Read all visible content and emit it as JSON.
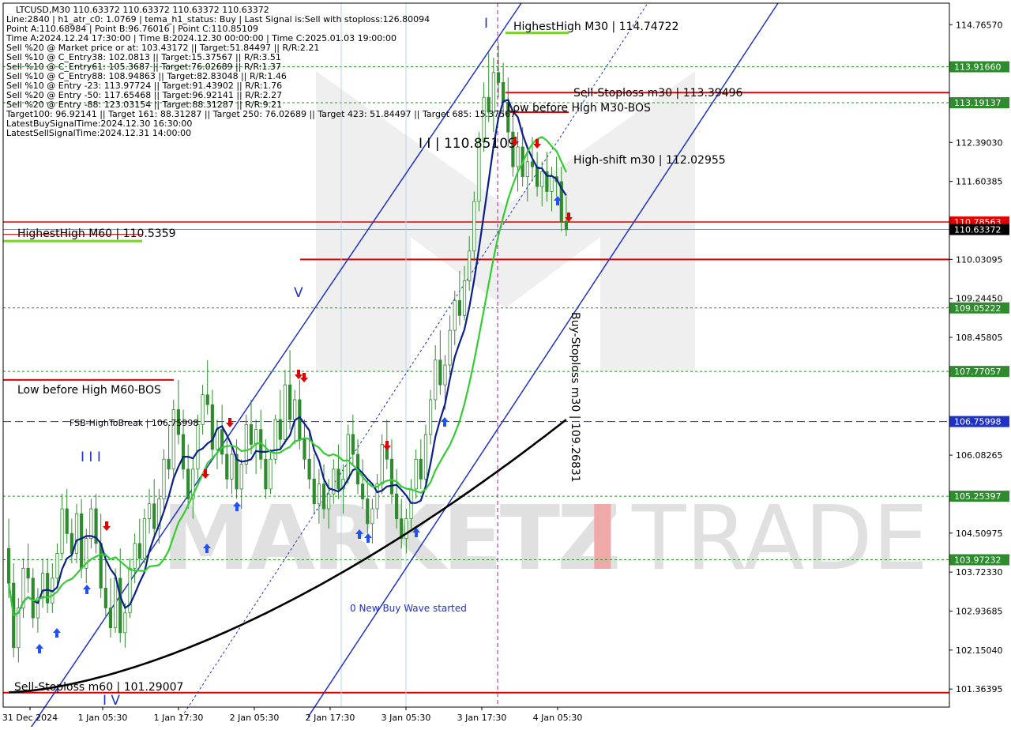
{
  "header": {
    "title": "LTCUSD,M30  110.63372 110.63372 110.63372 110.63372",
    "lines": [
      "Line:2840  |  h1_atr_c0: 1.0769  |  tema_h1_status: Buy  |  Last Signal is:Sell with stoploss:126.80094",
      "Point A:110.68984  |  Point B:96.76016  |  Point C:110.85109",
      "Time A:2024.12.24 17:30:00  |  Time B:2024.12.30 00:00:00  |  Time C:2025.01.03 19:00:00",
      "Sell %20 @ Market price or at: 103.43172  ||  Target:51.84497  ||  R/R:2.21",
      "Sell %10 @ C_Entry38: 102.0813  ||  Target:15.37567  ||  R/R:3.51",
      "Sell %10 @ C_Entry61: 105.3687  ||  Target:76.02689  ||  R/R:1.37",
      "Sell %10 @ C_Entry88: 108.94863  ||  Target:82.83048  ||  R/R:1.46",
      "Sell %10 @ Entry -23: 113.97724  ||  Target:91.43902  ||  R/R:1.76",
      "Sell %20 @ Entry -50: 117.65468  ||  Target:96.92141  ||  R/R:2.27",
      "Sell %20 @ Entry -88: 123.03154  ||  Target:88.31287  ||  R/R:9.21",
      "Target100: 96.92141  ||  Target 161: 88.31287  ||  Target 250: 76.02689  ||  Target 423: 51.84497  ||  Target 685: 15.37567",
      "LatestBuySignalTime:2024.12.30 16:30:00",
      "LatestSellSignalTime:2024.12.31 14:00:00"
    ]
  },
  "chart_data": {
    "type": "candlestick",
    "symbol": "LTCUSD",
    "timeframe": "M30",
    "ylim": [
      101.0,
      115.2
    ],
    "y_ticks": [
      "114.76570",
      "112.39030",
      "111.60385",
      "110.03095",
      "109.24450",
      "108.45805",
      "106.08265",
      "104.50975",
      "103.72330",
      "102.93685",
      "102.15040",
      "101.36395"
    ],
    "x_ticks": [
      "31 Dec 2024",
      "1 Jan 05:30",
      "1 Jan 17:30",
      "2 Jan 05:30",
      "2 Jan 17:30",
      "3 Jan 05:30",
      "3 Jan 17:30",
      "4 Jan 05:30"
    ],
    "x_count": 145,
    "current_price": {
      "value": 110.63372,
      "label": "110.63372"
    },
    "price_levels": [
      {
        "value": 113.9166,
        "label": "113.91660",
        "color": "#2e8b2e",
        "style": "dotted"
      },
      {
        "value": 113.19137,
        "label": "113.19137",
        "color": "#2e8b2e",
        "style": "dotted"
      },
      {
        "value": 110.78563,
        "label": "110.78563",
        "color": "#e00000",
        "style": "solid"
      },
      {
        "value": 109.05222,
        "label": "109.05222",
        "color": "#2e8b2e",
        "style": "dotted"
      },
      {
        "value": 107.77057,
        "label": "107.77057",
        "color": "#2e8b2e",
        "style": "dotted"
      },
      {
        "value": 106.75998,
        "label": "106.75998",
        "color": "#1e32c8",
        "style": "dashed"
      },
      {
        "value": 105.25397,
        "label": "105.25397",
        "color": "#2e8b2e",
        "style": "dotted"
      },
      {
        "value": 103.97232,
        "label": "103.97232",
        "color": "#2e8b2e",
        "style": "dotted"
      }
    ],
    "annotations": {
      "highest_high_m30": "HighestHigh   M30 | 114.74722",
      "sell_stoploss_m30": "Sell-Stoploss m30 | 113.39496",
      "low_before_high_m30": "Low before High   M30-BOS",
      "point_c": "I I | 110.85109",
      "high_shift_m30": "High-shift m30 | 112.02955",
      "highest_high_m60": "HighestHigh   M60 | 110.5359",
      "low_before_high_m60": "Low before High   M60-BOS",
      "fsb": "FSB-HighToBreak | 106.75998",
      "buy_stoploss_m30": "Buy-Stoploss m30 | 109.26831",
      "new_buy_wave": "0 New Buy Wave started",
      "sell_stoploss_m60": "Sell-Stoploss m60 | 101.29007",
      "wave_I": "I",
      "wave_V": "V",
      "wave_III": "I I I",
      "wave_IV": "I V"
    },
    "watermark": {
      "left": "MARKETZ",
      "accent": "I",
      "right": "TRADE"
    },
    "colors": {
      "bull": "#2e8b2e",
      "bear": "#2e8b2e",
      "ma_blue": "#0b1f8c",
      "ma_green": "#33cc33",
      "ma_black": "#000000",
      "channel": "#1e32c8",
      "red": "#e00000",
      "orange": "#ff6a1a"
    },
    "candles": [
      [
        104.2,
        104.8,
        103.2,
        103.5
      ],
      [
        103.5,
        103.9,
        102.0,
        102.2
      ],
      [
        102.2,
        103.2,
        101.9,
        103.0
      ],
      [
        103.0,
        104.0,
        102.8,
        103.8
      ],
      [
        103.8,
        104.3,
        103.3,
        103.6
      ],
      [
        103.6,
        103.8,
        102.6,
        102.8
      ],
      [
        102.8,
        103.4,
        102.5,
        103.2
      ],
      [
        103.2,
        104.0,
        103.0,
        103.7
      ],
      [
        103.7,
        104.0,
        102.9,
        103.1
      ],
      [
        103.1,
        103.9,
        102.9,
        103.6
      ],
      [
        103.6,
        104.3,
        103.4,
        104.1
      ],
      [
        104.1,
        105.3,
        104.0,
        105.0
      ],
      [
        105.0,
        105.4,
        104.3,
        104.5
      ],
      [
        104.5,
        104.8,
        103.9,
        104.1
      ],
      [
        104.1,
        105.1,
        103.9,
        104.9
      ],
      [
        104.9,
        105.2,
        103.6,
        103.8
      ],
      [
        103.8,
        104.6,
        103.5,
        104.4
      ],
      [
        104.4,
        105.2,
        104.2,
        105.0
      ],
      [
        105.0,
        105.3,
        104.1,
        104.3
      ],
      [
        104.3,
        104.9,
        103.2,
        103.4
      ],
      [
        103.4,
        104.1,
        102.8,
        103.0
      ],
      [
        103.0,
        103.6,
        102.4,
        102.6
      ],
      [
        102.6,
        103.8,
        102.5,
        103.6
      ],
      [
        103.6,
        104.2,
        102.3,
        102.5
      ],
      [
        102.5,
        103.1,
        102.2,
        102.9
      ],
      [
        102.9,
        104.0,
        102.8,
        103.8
      ],
      [
        103.8,
        104.5,
        103.5,
        104.3
      ],
      [
        104.3,
        104.8,
        103.8,
        104.0
      ],
      [
        104.0,
        105.0,
        103.9,
        104.8
      ],
      [
        104.8,
        105.4,
        104.5,
        105.1
      ],
      [
        105.1,
        105.6,
        104.4,
        104.6
      ],
      [
        104.6,
        105.4,
        104.3,
        105.2
      ],
      [
        105.2,
        106.2,
        105.0,
        106.0
      ],
      [
        106.0,
        106.7,
        105.6,
        105.8
      ],
      [
        105.8,
        107.2,
        105.6,
        107.0
      ],
      [
        107.0,
        107.6,
        106.3,
        106.5
      ],
      [
        106.5,
        107.0,
        105.6,
        105.8
      ],
      [
        105.8,
        106.3,
        105.0,
        105.2
      ],
      [
        105.2,
        106.0,
        104.8,
        105.8
      ],
      [
        105.8,
        106.9,
        105.6,
        106.7
      ],
      [
        106.7,
        107.5,
        106.5,
        107.3
      ],
      [
        107.3,
        108.0,
        106.9,
        107.1
      ],
      [
        107.1,
        107.4,
        106.0,
        106.2
      ],
      [
        106.2,
        106.8,
        105.8,
        106.6
      ],
      [
        106.6,
        107.1,
        105.9,
        106.1
      ],
      [
        106.1,
        106.5,
        105.4,
        105.6
      ],
      [
        105.6,
        106.3,
        105.3,
        106.1
      ],
      [
        106.1,
        106.4,
        105.2,
        105.4
      ],
      [
        105.4,
        106.0,
        105.0,
        105.9
      ],
      [
        105.9,
        106.9,
        105.7,
        106.7
      ],
      [
        106.7,
        107.2,
        106.1,
        106.3
      ],
      [
        106.3,
        106.8,
        105.7,
        106.6
      ],
      [
        106.6,
        107.0,
        105.8,
        106.0
      ],
      [
        106.0,
        106.4,
        105.2,
        105.4
      ],
      [
        105.4,
        106.2,
        105.3,
        106.0
      ],
      [
        106.0,
        106.9,
        105.9,
        106.8
      ],
      [
        106.8,
        107.4,
        106.2,
        106.4
      ],
      [
        106.4,
        107.8,
        106.3,
        107.5
      ],
      [
        107.5,
        108.2,
        106.6,
        106.8
      ],
      [
        106.8,
        107.4,
        106.3,
        107.2
      ],
      [
        107.2,
        107.6,
        106.2,
        106.4
      ],
      [
        106.4,
        106.8,
        105.8,
        106.0
      ],
      [
        106.0,
        106.6,
        105.4,
        105.6
      ],
      [
        105.6,
        106.1,
        104.9,
        105.1
      ],
      [
        105.1,
        105.8,
        104.7,
        105.5
      ],
      [
        105.5,
        105.9,
        104.8,
        105.0
      ],
      [
        105.0,
        105.6,
        104.6,
        105.3
      ],
      [
        105.3,
        106.0,
        105.1,
        105.8
      ],
      [
        105.8,
        106.3,
        105.2,
        105.4
      ],
      [
        105.4,
        105.9,
        104.9,
        105.6
      ],
      [
        105.6,
        106.7,
        105.5,
        106.5
      ],
      [
        106.5,
        106.9,
        105.9,
        106.1
      ],
      [
        106.1,
        106.4,
        105.3,
        105.5
      ],
      [
        105.5,
        106.0,
        105.0,
        105.2
      ],
      [
        105.2,
        105.6,
        104.5,
        104.7
      ],
      [
        104.7,
        105.2,
        104.3,
        105.0
      ],
      [
        105.0,
        105.7,
        104.8,
        105.5
      ],
      [
        105.5,
        106.5,
        105.3,
        106.3
      ],
      [
        106.3,
        106.8,
        105.8,
        106.0
      ],
      [
        106.0,
        106.4,
        105.1,
        105.3
      ],
      [
        105.3,
        105.8,
        104.6,
        104.8
      ],
      [
        104.8,
        105.2,
        104.2,
        104.4
      ],
      [
        104.4,
        105.0,
        104.1,
        104.8
      ],
      [
        104.8,
        105.6,
        104.6,
        105.4
      ],
      [
        105.4,
        106.2,
        105.2,
        106.0
      ],
      [
        106.0,
        106.4,
        105.4,
        105.6
      ],
      [
        105.6,
        106.7,
        105.5,
        106.5
      ],
      [
        106.5,
        107.4,
        106.3,
        107.2
      ],
      [
        107.2,
        108.3,
        107.0,
        108.0
      ],
      [
        108.0,
        108.6,
        107.3,
        107.5
      ],
      [
        107.5,
        108.1,
        107.0,
        107.9
      ],
      [
        107.9,
        108.9,
        107.7,
        108.6
      ],
      [
        108.6,
        109.4,
        108.3,
        109.2
      ],
      [
        109.2,
        109.8,
        108.7,
        108.9
      ],
      [
        108.9,
        109.9,
        108.8,
        109.6
      ],
      [
        109.6,
        110.5,
        109.4,
        110.2
      ],
      [
        110.2,
        111.4,
        110.0,
        111.2
      ],
      [
        111.2,
        112.6,
        111.0,
        112.4
      ],
      [
        112.4,
        113.6,
        112.2,
        113.3
      ],
      [
        113.3,
        114.2,
        112.8,
        113.0
      ],
      [
        113.0,
        114.1,
        112.6,
        113.8
      ],
      [
        113.8,
        114.4,
        113.3,
        113.6
      ],
      [
        113.6,
        114.0,
        112.9,
        113.2
      ],
      [
        113.2,
        113.7,
        112.3,
        112.6
      ],
      [
        112.6,
        113.0,
        111.7,
        111.9
      ],
      [
        111.9,
        112.6,
        111.4,
        112.3
      ],
      [
        112.3,
        112.7,
        111.5,
        111.7
      ],
      [
        111.7,
        112.3,
        111.2,
        112.0
      ],
      [
        112.0,
        112.5,
        111.6,
        111.9
      ],
      [
        111.9,
        112.2,
        111.3,
        111.5
      ],
      [
        111.5,
        112.0,
        111.1,
        111.8
      ],
      [
        111.8,
        112.2,
        111.2,
        111.4
      ],
      [
        111.4,
        111.9,
        111.0,
        111.7
      ],
      [
        111.7,
        112.1,
        111.3,
        111.6
      ],
      [
        111.6,
        111.9,
        110.6,
        110.8
      ],
      [
        110.8,
        111.3,
        110.5,
        110.63
      ]
    ]
  }
}
